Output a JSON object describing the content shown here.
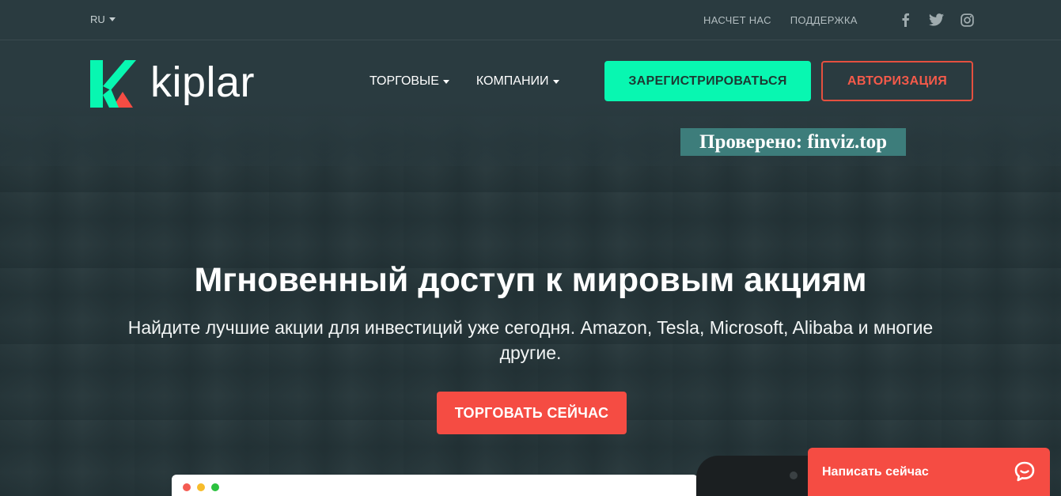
{
  "topbar": {
    "language": "RU",
    "links": [
      "НАСЧЕТ НАС",
      "ПОДДЕРЖКА"
    ],
    "social_icons": [
      "facebook-icon",
      "twitter-icon",
      "instagram-icon"
    ]
  },
  "brand": {
    "name": "kiplar",
    "colors": {
      "green": "#08f7b1",
      "red": "#f54c43"
    }
  },
  "nav": {
    "items": [
      "ТОРГОВЫЕ",
      "КОМПАНИИ"
    ],
    "register_label": "ЗАРЕГИСТРИРОВАТЬСЯ",
    "login_label": "АВТОРИЗАЦИЯ"
  },
  "watermark": "Проверено: finviz.top",
  "hero": {
    "title": "Мгновенный доступ к мировым акциям",
    "subtitle": "Найдите лучшие акции для инвестиций уже сегодня. Amazon, Tesla, Microsoft, Alibaba и многие другие.",
    "cta_label": "ТОРГОВАТЬ СЕЙЧАС"
  },
  "chat": {
    "label": "Написать сейчас",
    "icon": "chat-bubble-icon"
  }
}
